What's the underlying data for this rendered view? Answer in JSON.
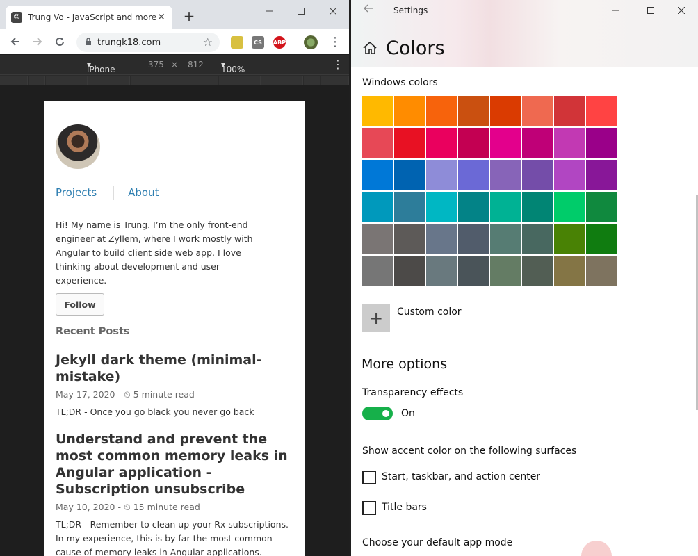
{
  "browser": {
    "tab_title": "Trung Vo - JavaScript and more",
    "tab_close": "✕",
    "new_tab": "+",
    "url": "trungk18.com",
    "icons": [
      "back-icon",
      "forward-icon",
      "reload-icon",
      "lock-icon",
      "star-icon",
      "menu-dots-icon"
    ],
    "ext_abp": "ABP",
    "ext_cs": "CS"
  },
  "devtools": {
    "device": "iPhone X",
    "width": "375",
    "times": "×",
    "height": "812",
    "zoom": "100%"
  },
  "site": {
    "nav": [
      "Projects",
      "About"
    ],
    "bio": "Hi! My name is Trung. I’m the only front-end engineer at Zyllem, where I work mostly with Angular to build client side web app. I love thinking about development and user experience.",
    "follow": "Follow",
    "recent_heading": "Recent Posts",
    "posts": [
      {
        "title": "Jekyll dark theme (minimal-mistake)",
        "date": "May 17, 2020",
        "read": "5 minute read",
        "excerpt": "TL;DR - Once you go black you never go back"
      },
      {
        "title": "Understand and prevent the most common memory leaks in Angular application - Subscription unsubscribe",
        "date": "May 10, 2020",
        "read": "15 minute read",
        "excerpt": "TL;DR - Remember to clean up your Rx subscriptions. In my experience, this is by far the most common cause of memory leaks in Angular applications."
      }
    ]
  },
  "settings": {
    "app_title": "Settings",
    "page_title": "Colors",
    "windows_colors": "Windows colors",
    "swatches": [
      [
        "#FFB900",
        "#FF8C00",
        "#F7630C",
        "#CA5010",
        "#DA3B01",
        "#EF6950",
        "#D13438",
        "#FF4343"
      ],
      [
        "#E74856",
        "#E81123",
        "#EA005E",
        "#C30052",
        "#E3008C",
        "#BF0077",
        "#C239B3",
        "#9A0089"
      ],
      [
        "#0078D7",
        "#0063B1",
        "#8E8CD8",
        "#6B69D6",
        "#8764B8",
        "#744DA9",
        "#B146C2",
        "#881798"
      ],
      [
        "#0099BC",
        "#2D7D9A",
        "#00B7C3",
        "#038387",
        "#00B294",
        "#018574",
        "#00CC6A",
        "#10893E"
      ],
      [
        "#7A7574",
        "#5D5A58",
        "#68768A",
        "#515C6B",
        "#567C73",
        "#486860",
        "#498205",
        "#107C10"
      ],
      [
        "#767676",
        "#4C4A48",
        "#69797E",
        "#4A5459",
        "#647C64",
        "#525E54",
        "#847545",
        "#7E735F"
      ]
    ],
    "custom_color": "Custom color",
    "more_options": "More options",
    "transparency_label": "Transparency effects",
    "transparency_state": "On",
    "accent_surfaces": "Show accent color on the following surfaces",
    "checkbox_start": "Start, taskbar, and action center",
    "checkbox_titlebars": "Title bars",
    "app_mode": "Choose your default app mode"
  }
}
